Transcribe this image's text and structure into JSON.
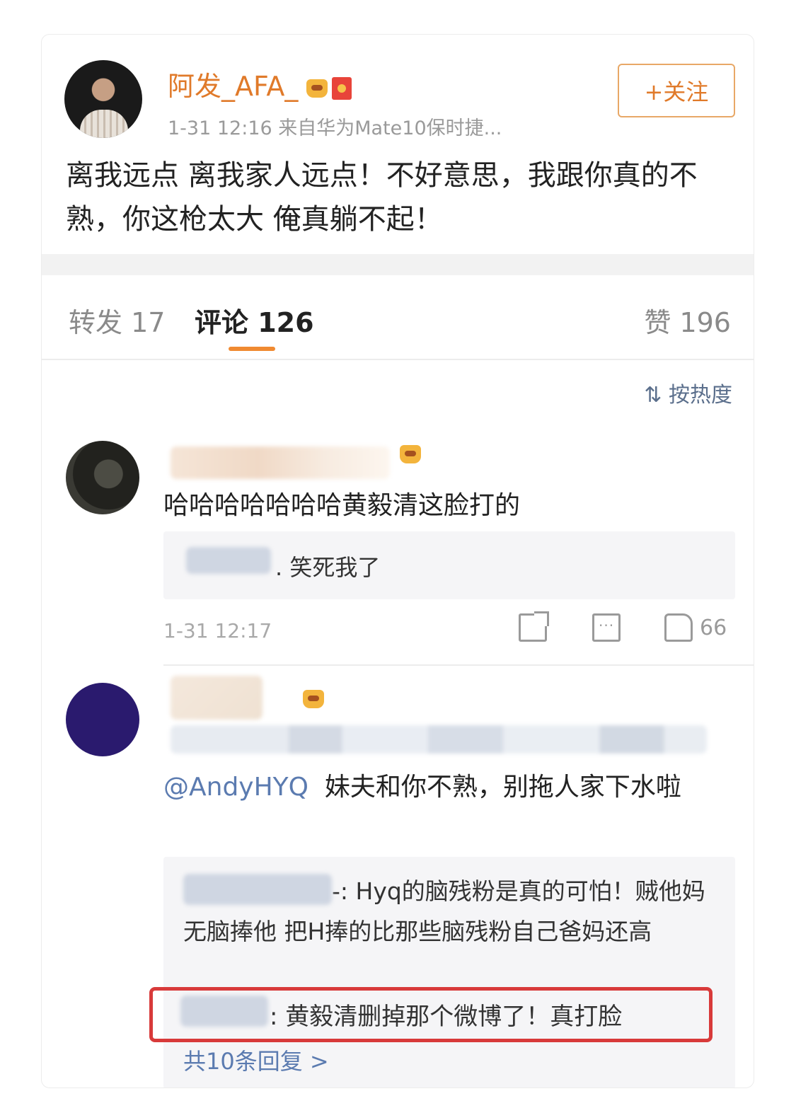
{
  "post": {
    "author": "阿发_AFA_",
    "meta": "1-31 12:16  来自华为Mate10保时捷...",
    "follow_label": "+关注",
    "text": "离我远点 离我家人远点！不好意思，我跟你真的不熟，你这枪太大 俺真躺不起！"
  },
  "tabs": {
    "repost": "转发 17",
    "comments": "评论 126",
    "likes": "赞 196"
  },
  "sort_label": "按热度",
  "sort_icon": "sort-icon",
  "comments": [
    {
      "text": "哈哈哈哈哈哈哈黄毅清这脸打的",
      "reply": ". 笑死我了",
      "time": "1-31 12:17",
      "like_count": "66"
    },
    {
      "mention": "@AndyHYQ",
      "text": "妹夫和你不熟，别拖人家下水啦",
      "reply1": "-: Hyq的脑残粉是真的可怕！贼他妈无脑捧他  把H捧的比那些脑残粉自己爸妈还高",
      "reply2": ": 黄毅清删掉那个微博了！真打脸",
      "more_replies": "共10条回复 >"
    }
  ],
  "colors": {
    "accent_orange": "#e07a2a",
    "link_blue": "#5b7bb0",
    "highlight_red": "#d83a3a"
  }
}
